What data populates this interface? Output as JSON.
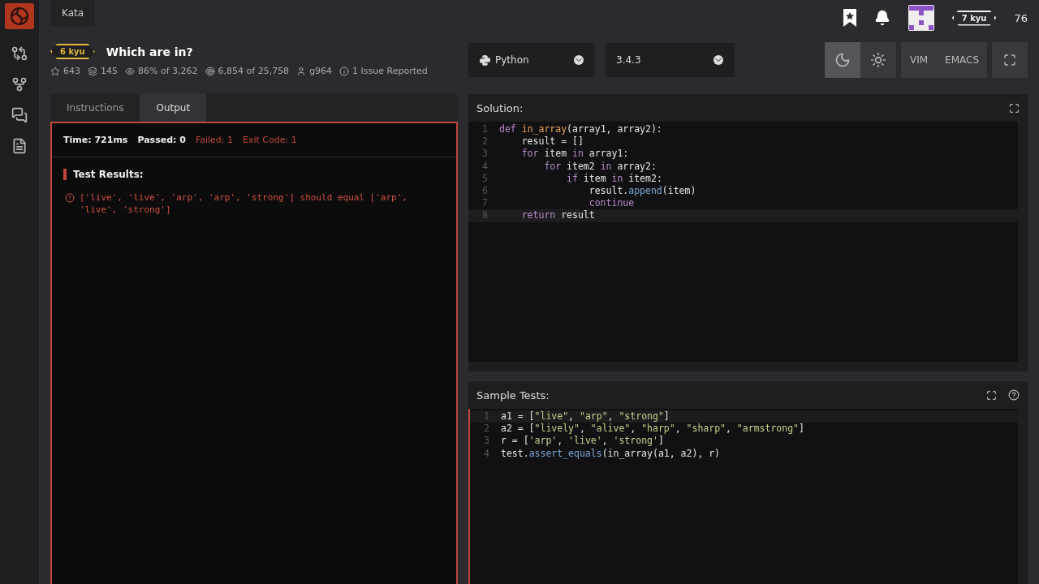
{
  "topbar": {
    "section": "Kata",
    "rank": "7 kyu",
    "honor": "76"
  },
  "kata": {
    "rank": "6 kyu",
    "title": "Which are in?",
    "stats": [
      {
        "kind": "stars",
        "text": "643"
      },
      {
        "kind": "collections",
        "text": "145"
      },
      {
        "kind": "satisfaction",
        "text": "86% of 3,262"
      },
      {
        "kind": "completed",
        "text": "6,854 of 25,758"
      },
      {
        "kind": "author",
        "text": "g964"
      },
      {
        "kind": "issues",
        "text": "1 Issue Reported"
      }
    ]
  },
  "tabs": [
    {
      "label": "Instructions",
      "selected": false
    },
    {
      "label": "Output",
      "selected": true
    }
  ],
  "output": {
    "summary": [
      {
        "text": "Time: 721ms",
        "failed": false
      },
      {
        "text": "Passed: 0",
        "failed": false
      },
      {
        "text": "Failed: 1",
        "failed": true
      },
      {
        "text": "Exit Code: 1",
        "failed": true
      }
    ],
    "heading": "Test Results:",
    "error": "['live', 'live', 'arp', 'arp', 'strong'] should equal ['arp', 'live', 'strong']"
  },
  "editor_toolbar": {
    "language": "Python",
    "version": "3.4.3",
    "themes": [
      {
        "kind": "dark",
        "selected": true
      },
      {
        "kind": "light",
        "selected": false
      }
    ],
    "modes": [
      "VIM",
      "EMACS"
    ]
  },
  "solution": {
    "title": "Solution:",
    "lines": [
      {
        "number": "1",
        "active": false,
        "tokens": [
          {
            "kind": "keyword",
            "text": "def "
          },
          {
            "kind": "func",
            "text": "in_array"
          },
          {
            "kind": "plain",
            "text": "(array1, array2):"
          }
        ]
      },
      {
        "number": "2",
        "active": false,
        "tokens": [
          {
            "kind": "plain",
            "text": "    result = []"
          }
        ]
      },
      {
        "number": "3",
        "active": false,
        "tokens": [
          {
            "kind": "keyword",
            "text": "    for "
          },
          {
            "kind": "plain",
            "text": "item "
          },
          {
            "kind": "keyword",
            "text": "in "
          },
          {
            "kind": "plain",
            "text": "array1:"
          }
        ]
      },
      {
        "number": "4",
        "active": false,
        "tokens": [
          {
            "kind": "keyword",
            "text": "        for "
          },
          {
            "kind": "plain",
            "text": "item2 "
          },
          {
            "kind": "keyword",
            "text": "in "
          },
          {
            "kind": "plain",
            "text": "array2:"
          }
        ]
      },
      {
        "number": "5",
        "active": false,
        "tokens": [
          {
            "kind": "keyword",
            "text": "            if "
          },
          {
            "kind": "plain",
            "text": "item "
          },
          {
            "kind": "keyword",
            "text": "in "
          },
          {
            "kind": "plain",
            "text": "item2:"
          }
        ]
      },
      {
        "number": "6",
        "active": false,
        "tokens": [
          {
            "kind": "plain",
            "text": "                result."
          },
          {
            "kind": "method",
            "text": "append"
          },
          {
            "kind": "plain",
            "text": "(item)"
          }
        ]
      },
      {
        "number": "7",
        "active": false,
        "tokens": [
          {
            "kind": "keyword",
            "text": "                continue"
          }
        ]
      },
      {
        "number": "8",
        "active": true,
        "tokens": [
          {
            "kind": "keyword",
            "text": "    return "
          },
          {
            "kind": "plain",
            "text": "result"
          }
        ]
      }
    ]
  },
  "sample_tests": {
    "title": "Sample Tests:",
    "lines": [
      {
        "number": "1",
        "active": true,
        "tokens": [
          {
            "kind": "plain",
            "text": "a1 = ["
          },
          {
            "kind": "string",
            "text": "\"live\""
          },
          {
            "kind": "plain",
            "text": ", "
          },
          {
            "kind": "string",
            "text": "\"arp\""
          },
          {
            "kind": "plain",
            "text": ", "
          },
          {
            "kind": "string",
            "text": "\"strong\""
          },
          {
            "kind": "plain",
            "text": "]"
          }
        ]
      },
      {
        "number": "2",
        "active": false,
        "tokens": [
          {
            "kind": "plain",
            "text": "a2 = ["
          },
          {
            "kind": "string",
            "text": "\"lively\""
          },
          {
            "kind": "plain",
            "text": ", "
          },
          {
            "kind": "string",
            "text": "\"alive\""
          },
          {
            "kind": "plain",
            "text": ", "
          },
          {
            "kind": "string",
            "text": "\"harp\""
          },
          {
            "kind": "plain",
            "text": ", "
          },
          {
            "kind": "string",
            "text": "\"sharp\""
          },
          {
            "kind": "plain",
            "text": ", "
          },
          {
            "kind": "string",
            "text": "\"armstrong\""
          },
          {
            "kind": "plain",
            "text": "]"
          }
        ]
      },
      {
        "number": "3",
        "active": false,
        "tokens": [
          {
            "kind": "plain",
            "text": "r = ["
          },
          {
            "kind": "string",
            "text": "'arp'"
          },
          {
            "kind": "plain",
            "text": ", "
          },
          {
            "kind": "string",
            "text": "'live'"
          },
          {
            "kind": "plain",
            "text": ", "
          },
          {
            "kind": "string",
            "text": "'strong'"
          },
          {
            "kind": "plain",
            "text": "]"
          }
        ]
      },
      {
        "number": "4",
        "active": false,
        "tokens": [
          {
            "kind": "plain",
            "text": "test."
          },
          {
            "kind": "method",
            "text": "assert_equals"
          },
          {
            "kind": "plain",
            "text": "(in_array(a1, a2), r)"
          }
        ]
      }
    ]
  }
}
